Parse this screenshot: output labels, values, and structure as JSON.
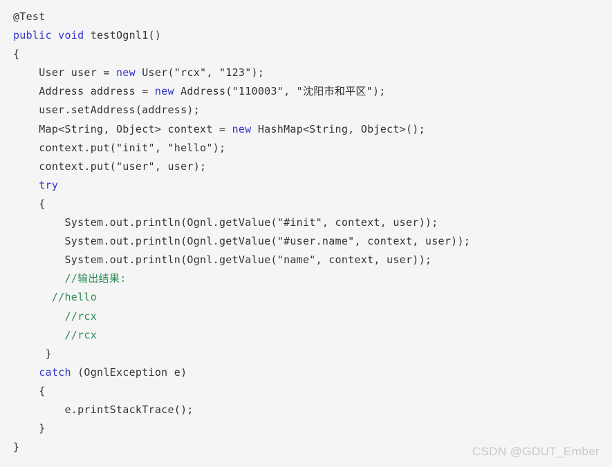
{
  "page": {
    "background_color": "#f5f5f5",
    "language": "java"
  },
  "theme": {
    "keyword_color": "#3333cc",
    "comment_color": "#2e8b57",
    "plain_color": "#333333",
    "watermark_color": "#c9c9c9"
  },
  "code": {
    "lines": [
      {
        "indent": "",
        "tokens": [
          {
            "t": "plain",
            "s": "@Test"
          }
        ]
      },
      {
        "indent": "",
        "tokens": [
          {
            "t": "kw",
            "s": "public void"
          },
          {
            "t": "plain",
            "s": " testOgnl1()"
          }
        ]
      },
      {
        "indent": "",
        "tokens": [
          {
            "t": "plain",
            "s": "{"
          }
        ]
      },
      {
        "indent": "    ",
        "tokens": [
          {
            "t": "plain",
            "s": "User user = "
          },
          {
            "t": "kw",
            "s": "new"
          },
          {
            "t": "plain",
            "s": " User(\"rcx\", \"123\");"
          }
        ]
      },
      {
        "indent": "    ",
        "tokens": [
          {
            "t": "plain",
            "s": "Address address = "
          },
          {
            "t": "kw",
            "s": "new"
          },
          {
            "t": "plain",
            "s": " Address(\"110003\", \"沈阳市和平区\");"
          }
        ]
      },
      {
        "indent": "    ",
        "tokens": [
          {
            "t": "plain",
            "s": "user.setAddress(address);"
          }
        ]
      },
      {
        "indent": "    ",
        "tokens": [
          {
            "t": "plain",
            "s": "Map<String, Object> context = "
          },
          {
            "t": "kw",
            "s": "new"
          },
          {
            "t": "plain",
            "s": " HashMap<String, Object>();"
          }
        ]
      },
      {
        "indent": "    ",
        "tokens": [
          {
            "t": "plain",
            "s": "context.put(\"init\", \"hello\");"
          }
        ]
      },
      {
        "indent": "    ",
        "tokens": [
          {
            "t": "plain",
            "s": "context.put(\"user\", user);"
          }
        ]
      },
      {
        "indent": "    ",
        "tokens": [
          {
            "t": "kw",
            "s": "try"
          }
        ]
      },
      {
        "indent": "    ",
        "tokens": [
          {
            "t": "plain",
            "s": "{"
          }
        ]
      },
      {
        "indent": "        ",
        "tokens": [
          {
            "t": "plain",
            "s": "System.out.println(Ognl.getValue(\"#init\", context, user));"
          }
        ]
      },
      {
        "indent": "        ",
        "tokens": [
          {
            "t": "plain",
            "s": "System.out.println(Ognl.getValue(\"#user.name\", context, user));"
          }
        ]
      },
      {
        "indent": "        ",
        "tokens": [
          {
            "t": "plain",
            "s": "System.out.println(Ognl.getValue(\"name\", context, user));"
          }
        ]
      },
      {
        "indent": "        ",
        "tokens": [
          {
            "t": "cmt",
            "s": "//输出结果:"
          }
        ]
      },
      {
        "indent": "      ",
        "tokens": [
          {
            "t": "cmt",
            "s": "//hello"
          }
        ]
      },
      {
        "indent": "        ",
        "tokens": [
          {
            "t": "cmt",
            "s": "//rcx"
          }
        ]
      },
      {
        "indent": "        ",
        "tokens": [
          {
            "t": "cmt",
            "s": "//rcx"
          }
        ]
      },
      {
        "indent": "     ",
        "tokens": [
          {
            "t": "plain",
            "s": "}"
          }
        ]
      },
      {
        "indent": "    ",
        "tokens": [
          {
            "t": "kw",
            "s": "catch"
          },
          {
            "t": "plain",
            "s": " (OgnlException e)"
          }
        ]
      },
      {
        "indent": "    ",
        "tokens": [
          {
            "t": "plain",
            "s": "{"
          }
        ]
      },
      {
        "indent": "        ",
        "tokens": [
          {
            "t": "plain",
            "s": "e.printStackTrace();"
          }
        ]
      },
      {
        "indent": "    ",
        "tokens": [
          {
            "t": "plain",
            "s": "}"
          }
        ]
      },
      {
        "indent": "",
        "tokens": [
          {
            "t": "plain",
            "s": "}"
          }
        ]
      }
    ]
  },
  "watermark": {
    "text": "CSDN @GDUT_Ember"
  }
}
